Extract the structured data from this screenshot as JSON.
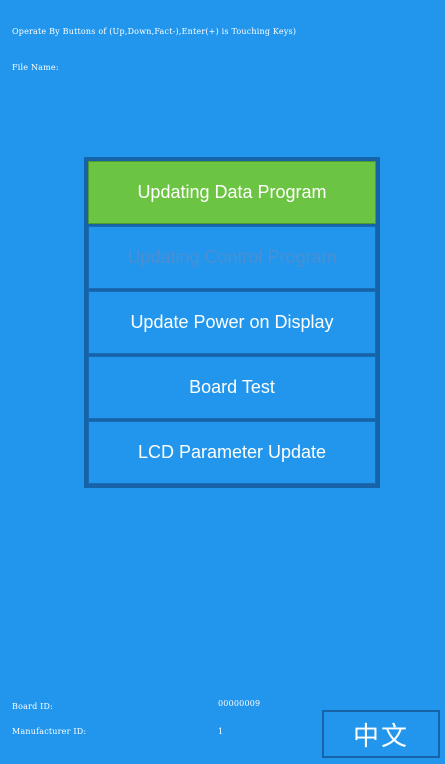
{
  "header": {
    "instruction": "Operate By Buttons of (Up,Down,Fact-),Enter(+) is Touching Keys)",
    "file_name_label": "File Name:",
    "file_name_value": ""
  },
  "menu": {
    "items": [
      {
        "label": "Updating Data Program",
        "state": "selected"
      },
      {
        "label": "Updating Control Program",
        "state": "disabled"
      },
      {
        "label": "Update Power on Display",
        "state": "normal"
      },
      {
        "label": "Board Test",
        "state": "normal"
      },
      {
        "label": "LCD Parameter Update",
        "state": "normal"
      }
    ]
  },
  "footer": {
    "board_id_label": "Board ID:",
    "board_id_value": "00000009",
    "manufacturer_id_label": "Manufacturer ID:",
    "manufacturer_id_value": "1",
    "language_button_label": "中文"
  },
  "colors": {
    "background": "#2196ec",
    "selected": "#6cc443",
    "border": "#1763a8",
    "disabled_text": "#4c8fd2"
  }
}
